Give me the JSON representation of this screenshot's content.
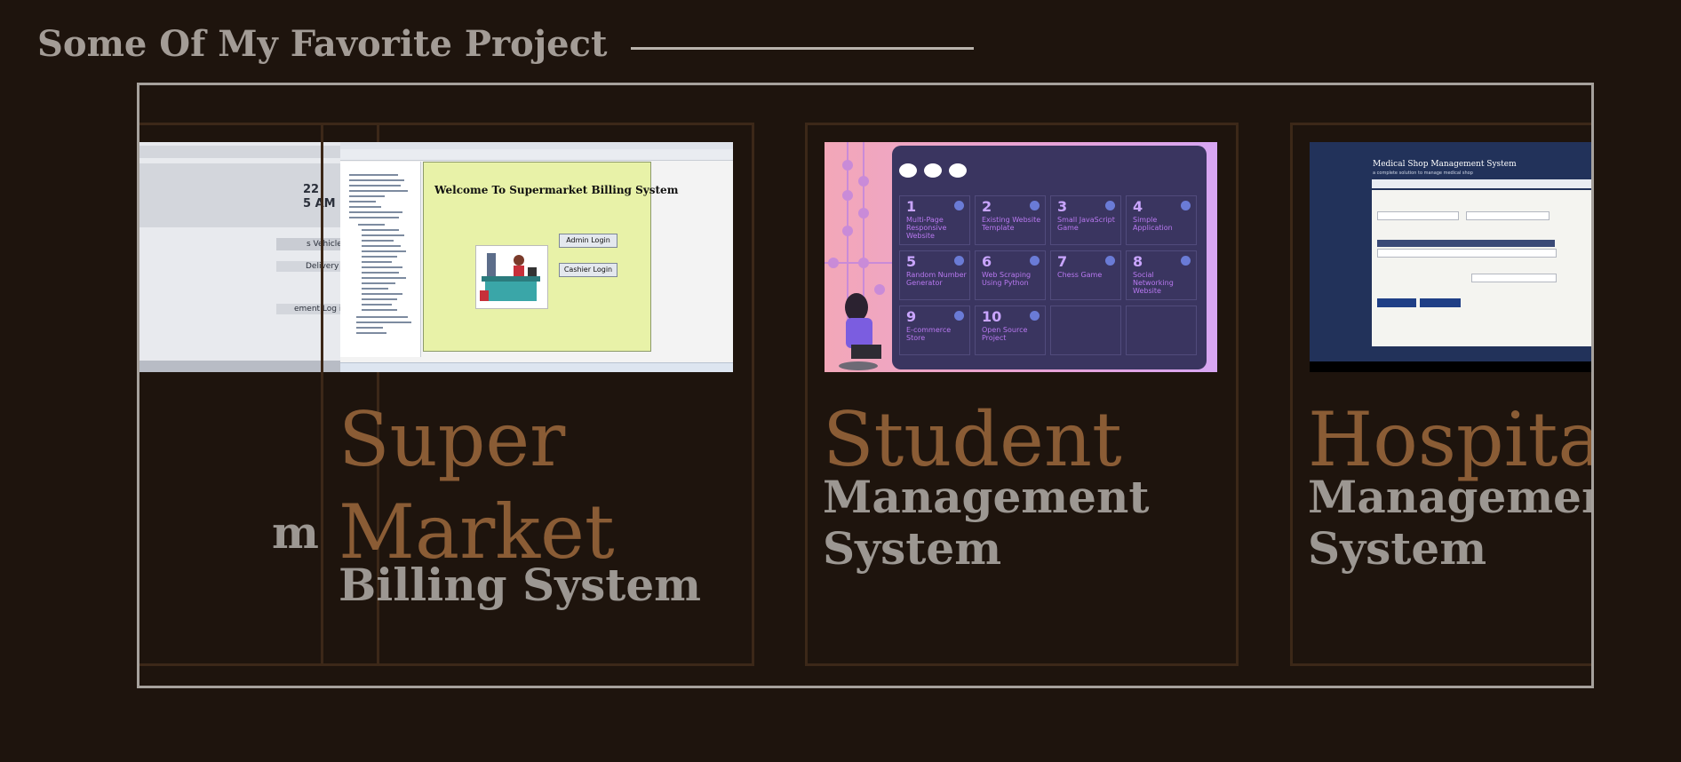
{
  "section": {
    "title": "Some Of My Favorite Project"
  },
  "cards": [
    {
      "title": "",
      "subtitle": "m",
      "thumb": {
        "time_lines": [
          "22",
          "5 AM"
        ],
        "buttons": [
          "s Vehicle",
          "Delivery",
          "ement Log in"
        ]
      }
    },
    {
      "title_lines": [
        "Super",
        "Market"
      ],
      "subtitle": "Billing System",
      "thumb": {
        "dialog_title": "Welcome To Supermarket Billing System",
        "buttons": [
          "Admin Login",
          "Cashier Login"
        ]
      }
    },
    {
      "title": "Student",
      "subtitle_lines": [
        "Management",
        "System"
      ],
      "thumb": {
        "cells": [
          {
            "num": "1",
            "label": "Multi-Page Responsive Website"
          },
          {
            "num": "2",
            "label": "Existing Website Template"
          },
          {
            "num": "3",
            "label": "Small JavaScript Game"
          },
          {
            "num": "4",
            "label": "Simple Application"
          },
          {
            "num": "5",
            "label": "Random Number Generator"
          },
          {
            "num": "6",
            "label": "Web Scraping Using Python"
          },
          {
            "num": "7",
            "label": "Chess Game"
          },
          {
            "num": "8",
            "label": "Social Networking Website"
          },
          {
            "num": "9",
            "label": "E-commerce Store"
          },
          {
            "num": "10",
            "label": "Open Source Project"
          }
        ]
      }
    },
    {
      "title": "Hospital",
      "subtitle_lines": [
        "Management",
        "System"
      ],
      "thumb": {
        "page_title": "Medical Shop Management System",
        "page_sub": "a complete solution to manage medical shop"
      }
    }
  ],
  "colors": {
    "background": "#1e140d",
    "title_gray": "#a39c96",
    "card_title_brown": "#8a5c35",
    "card_subtitle_gray": "#9c9792",
    "card_border": "#3c2818",
    "carousel_border": "#a6a19c"
  }
}
